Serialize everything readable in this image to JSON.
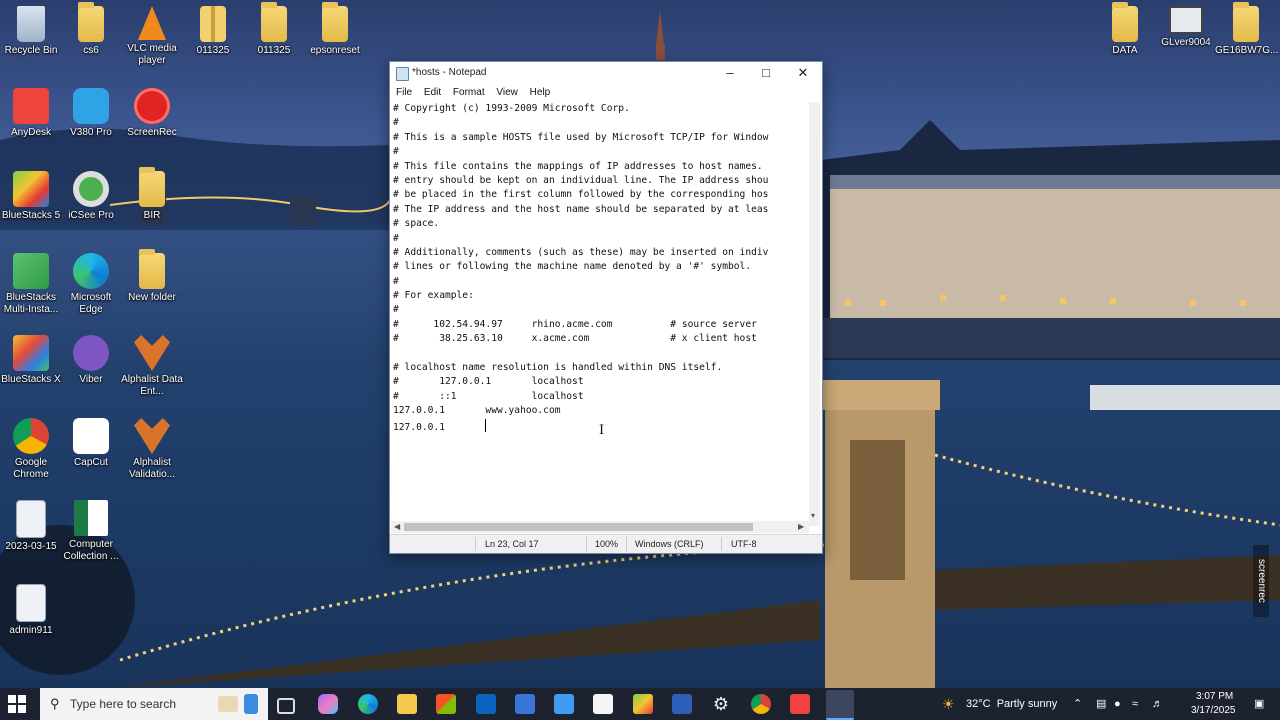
{
  "desktop": {
    "icons_left": [
      {
        "label": "Recycle Bin",
        "type": "recycle"
      },
      {
        "label": "cs6",
        "type": "folder"
      },
      {
        "label": "VLC media player",
        "type": "vlc"
      },
      {
        "label": "011325",
        "type": "zip"
      },
      {
        "label": "011325",
        "type": "folder-doc"
      },
      {
        "label": "epsonreset",
        "type": "folder-doc"
      },
      {
        "label": "AnyDesk",
        "type": "anydesk"
      },
      {
        "label": "V380 Pro",
        "type": "v380"
      },
      {
        "label": "ScreenRec",
        "type": "screenrec"
      },
      {
        "label": "BlueStacks 5",
        "type": "bluestacks"
      },
      {
        "label": "iCSee Pro",
        "type": "icsee"
      },
      {
        "label": "BIR",
        "type": "folder"
      },
      {
        "label": "BlueStacks Multi-Insta...",
        "type": "bluestacks-multi"
      },
      {
        "label": "Microsoft Edge",
        "type": "edge"
      },
      {
        "label": "New folder",
        "type": "folder"
      },
      {
        "label": "BlueStacks X",
        "type": "bluestacks-x"
      },
      {
        "label": "Viber",
        "type": "viber"
      },
      {
        "label": "Alphalist Data Ent...",
        "type": "alphalist"
      },
      {
        "label": "Google Chrome",
        "type": "chrome"
      },
      {
        "label": "CapCut",
        "type": "capcut"
      },
      {
        "label": "Alphalist Validatio...",
        "type": "alphalist"
      },
      {
        "label": "2023-03-15",
        "type": "doc"
      },
      {
        "label": "Computer Collection ...",
        "type": "excel"
      },
      {
        "label": "admin911",
        "type": "doc"
      }
    ],
    "icons_right": [
      {
        "label": "DATA",
        "type": "folder-doc"
      },
      {
        "label": "GLver9004",
        "type": "computer"
      },
      {
        "label": "GE16BW7G...",
        "type": "folder-doc"
      }
    ],
    "watermark": "screenrec"
  },
  "notepad": {
    "title": "*hosts - Notepad",
    "menu": [
      "File",
      "Edit",
      "Format",
      "View",
      "Help"
    ],
    "lines": [
      "# Copyright (c) 1993-2009 Microsoft Corp.",
      "#",
      "# This is a sample HOSTS file used by Microsoft TCP/IP for Window",
      "#",
      "# This file contains the mappings of IP addresses to host names.",
      "# entry should be kept on an individual line. The IP address shou",
      "# be placed in the first column followed by the corresponding hos",
      "# The IP address and the host name should be separated by at leas",
      "# space.",
      "#",
      "# Additionally, comments (such as these) may be inserted on indiv",
      "# lines or following the machine name denoted by a '#' symbol.",
      "#",
      "# For example:",
      "#",
      "#      102.54.94.97     rhino.acme.com          # source server",
      "#       38.25.63.10     x.acme.com              # x client host",
      "",
      "# localhost name resolution is handled within DNS itself.",
      "#       127.0.0.1       localhost",
      "#       ::1             localhost",
      "127.0.0.1       www.yahoo.com",
      "127.0.0.1       "
    ],
    "status": {
      "position": "Ln 23, Col 17",
      "zoom": "100%",
      "line_ending": "Windows (CRLF)",
      "encoding": "UTF-8"
    }
  },
  "taskbar": {
    "search_placeholder": "Type here to search",
    "weather": "32°C  Partly sunny",
    "time": "3:07 PM",
    "date": "3/17/2025",
    "pinned": [
      "task-view",
      "copilot",
      "edge",
      "file-explorer",
      "store",
      "outlook",
      "snipping",
      "paint",
      "capcut",
      "bluestacks",
      "word",
      "settings",
      "chrome",
      "anydesk",
      "notepad"
    ]
  }
}
